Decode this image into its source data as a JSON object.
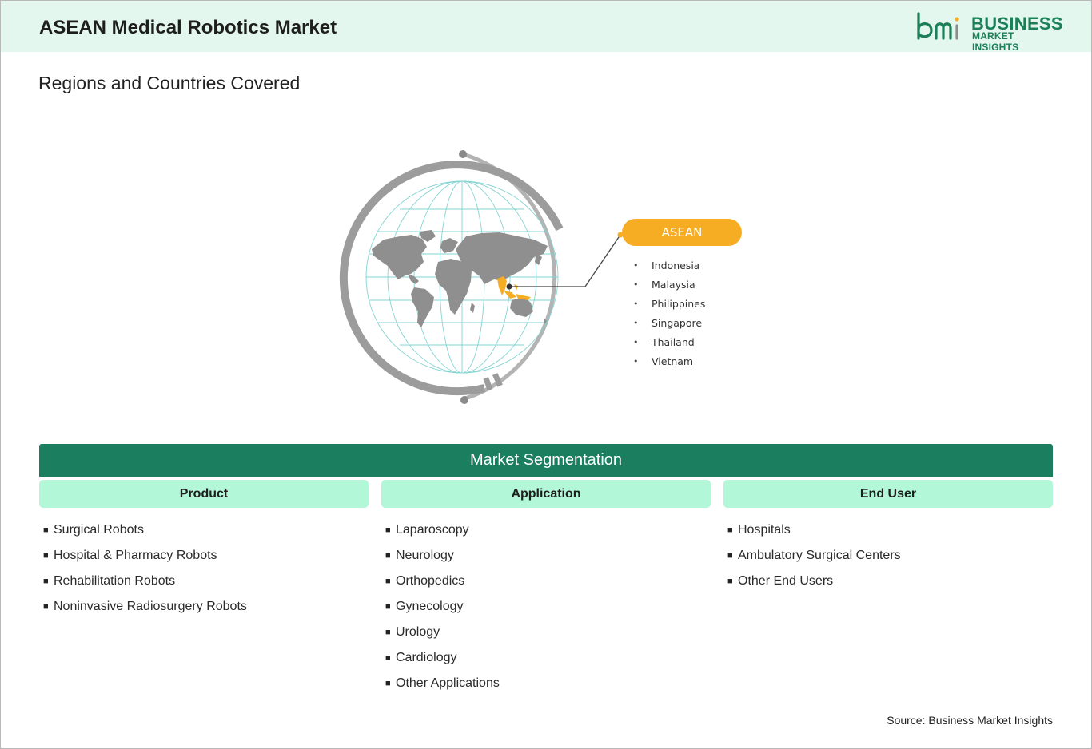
{
  "header": {
    "title": "ASEAN Medical Robotics Market",
    "logo_line1": "BUSINESS",
    "logo_line2": "MARKET INSIGHTS"
  },
  "subtitle": "Regions and Countries Covered",
  "region": {
    "name": "ASEAN",
    "countries": [
      "Indonesia",
      "Malaysia",
      "Philippines",
      "Singapore",
      "Thailand",
      "Vietnam"
    ]
  },
  "segmentation": {
    "title": "Market Segmentation",
    "columns": [
      {
        "header": "Product",
        "items": [
          "Surgical Robots",
          "Hospital & Pharmacy Robots",
          "Rehabilitation Robots",
          "Noninvasive Radiosurgery Robots"
        ]
      },
      {
        "header": "Application",
        "items": [
          "Laparoscopy",
          "Neurology",
          "Orthopedics",
          "Gynecology",
          "Urology",
          "Cardiology",
          "Other Applications"
        ]
      },
      {
        "header": "End User",
        "items": [
          "Hospitals",
          "Ambulatory Surgical Centers",
          "Other End Users"
        ]
      }
    ]
  },
  "bullet_glyph": "•",
  "square_glyph": "■",
  "source": "Source: Business Market Insights",
  "colors": {
    "brand_green": "#1b7f5f",
    "header_bg": "#e3f7ee",
    "column_header_bg": "#b1f7d8",
    "asean_orange": "#f6ad24",
    "ring_gray": "#a8a8a8",
    "grid_teal": "#7fcfcf"
  },
  "icons": [
    "bmi-logo-icon",
    "world-globe-icon"
  ]
}
